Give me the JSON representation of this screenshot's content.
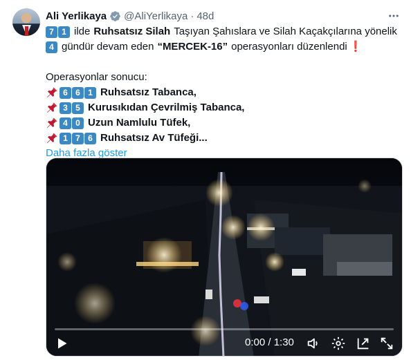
{
  "author": {
    "name": "Ali Yerlikaya",
    "handle": "@AliYerlikaya",
    "separator": "·",
    "age": "48d"
  },
  "tweet": {
    "line1": {
      "digits": [
        "7",
        "1"
      ],
      "text_a": "ilde",
      "bold": "Ruhsatsız Silah",
      "text_b": "Taşıyan Şahıslara ve Silah Kaçakçılarına yönelik"
    },
    "line2": {
      "digits": [
        "4"
      ],
      "text_a": "gündür devam eden",
      "bold": "“MERCEK-16”",
      "text_b": "operasyonları düzenlendi",
      "mark": "❗"
    },
    "results_heading": "Operasyonlar sonucu:",
    "results": [
      {
        "digits": [
          "6",
          "6",
          "1"
        ],
        "label": "Ruhsatsız Tabanca,"
      },
      {
        "digits": [
          "3",
          "5"
        ],
        "label": "Kurusıkıdan Çevrilmiş Tabanca,"
      },
      {
        "digits": [
          "4",
          "0"
        ],
        "label": "Uzun Namlulu Tüfek,"
      },
      {
        "digits": [
          "1",
          "7",
          "6"
        ],
        "label": "Ruhsatsız Av Tüfeği..."
      }
    ],
    "show_more": "Daha fazla göster"
  },
  "video": {
    "time": "0:00 / 1:30",
    "progress": 0
  },
  "colors": {
    "accent": "#1d9bf0",
    "keycap": "#3b88c3",
    "muted": "#536471",
    "pin": "#dd2e44"
  },
  "icons": [
    "verified-badge-icon",
    "more-icon",
    "pushpin-icon",
    "play-icon",
    "volume-icon",
    "settings-icon",
    "pip-icon",
    "fullscreen-icon"
  ]
}
